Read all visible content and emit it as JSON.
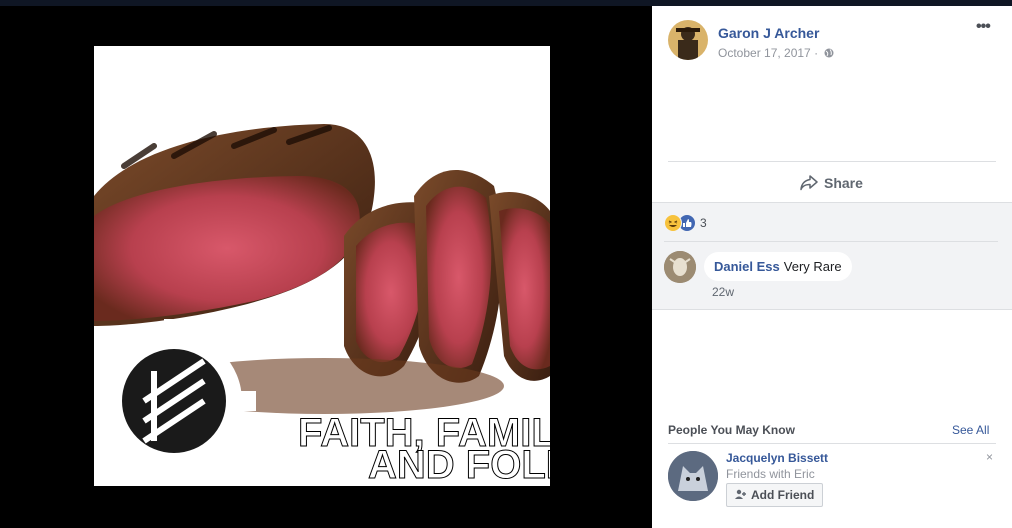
{
  "post": {
    "author": "Garon J Archer",
    "date": "October 17, 2017 ·",
    "privacy_icon": "globe-icon",
    "more_label": "•••",
    "share_label": "Share",
    "image_text_line1": "FAITH, FAMILY",
    "image_text_line2": "AND FOLK"
  },
  "reactions": {
    "count": "3",
    "types": [
      "haha",
      "like"
    ]
  },
  "comment": {
    "author": "Daniel Ess",
    "text": "Very Rare",
    "time": "22w"
  },
  "pymk": {
    "title": "People You May Know",
    "see_all": "See All",
    "person": {
      "name": "Jacquelyn Bissett",
      "subtitle": "Friends with Eric",
      "add_label": "Add Friend"
    },
    "close_label": "×"
  },
  "colors": {
    "link": "#365899",
    "panel_bg": "#ffffff",
    "comment_bg": "#f2f3f5",
    "photo_bg": "#000000"
  }
}
